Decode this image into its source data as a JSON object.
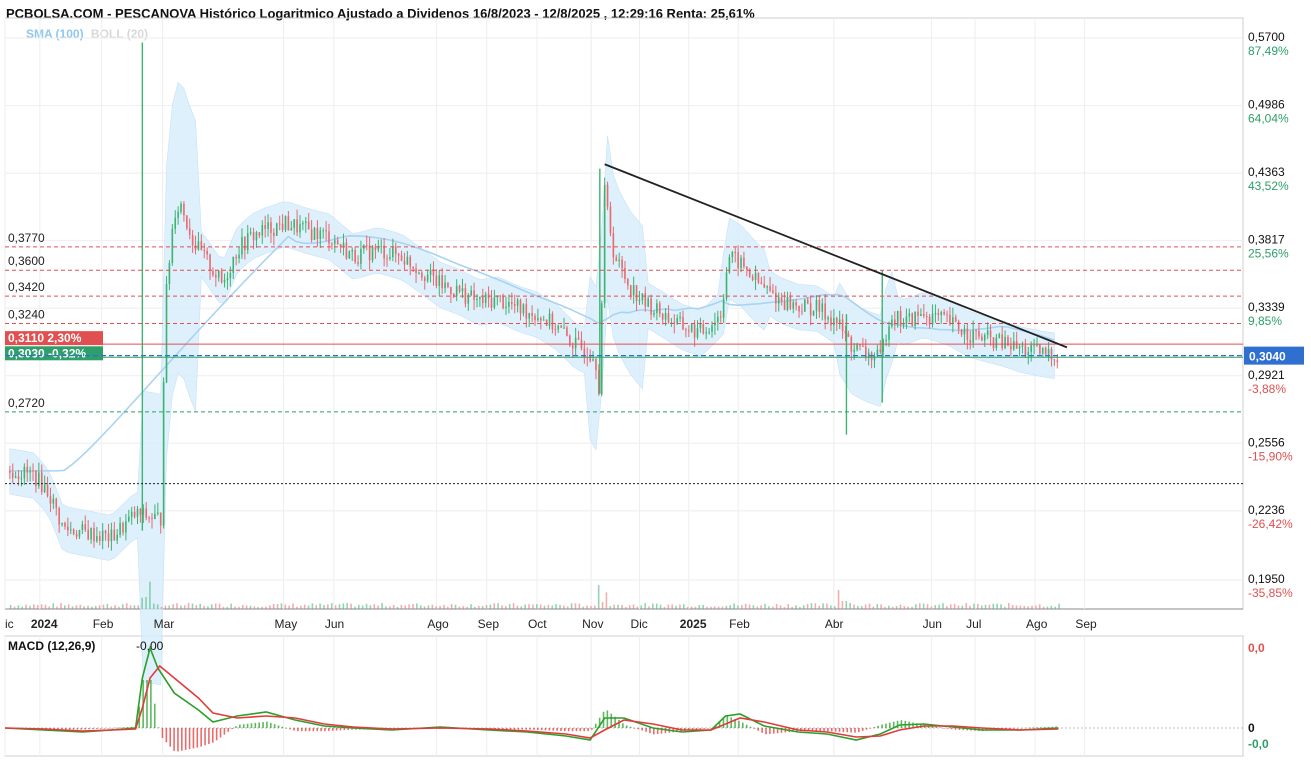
{
  "header": {
    "title": "PCBOLSA.COM - PESCANOVA Histórico Logaritmico Ajustado a Dividenos 16/8/2023 - 12/8/2025 , 12:29:16 Renta: 25,61%",
    "indicator_sma": "SMA (100)",
    "indicator_boll": "BOLL (20)"
  },
  "colors": {
    "up": "#3cb371",
    "down": "#e8696e",
    "band_fill": "#d6ecfb",
    "sma": "#a9d3f2",
    "resistance": "#e05050",
    "support": "#2e9e6a",
    "current": "#2f6fd0",
    "trendline": "#222222",
    "macd_line": "#2aa02a",
    "signal_line": "#e23b3b"
  },
  "chart_data": [
    {
      "type": "candlestick",
      "scale": "log",
      "ylim": [
        0.195,
        0.57
      ],
      "y_ticks": [
        {
          "value": "0,5700",
          "pct": "87,49%"
        },
        {
          "value": "0,4986",
          "pct": "64,04%"
        },
        {
          "value": "0,4363",
          "pct": "43,52%"
        },
        {
          "value": "0,3817",
          "pct": "25,56%"
        },
        {
          "value": "0,3339",
          "pct": "9,85%"
        },
        {
          "value": "0,2921",
          "pct": "-3,88%"
        },
        {
          "value": "0,2556",
          "pct": "-15,90%"
        },
        {
          "value": "0,2236",
          "pct": "-26,42%"
        },
        {
          "value": "0,1950",
          "pct": "-35,85%"
        }
      ],
      "x_ticks": [
        {
          "label": "ic",
          "t": 0.0,
          "bold": false
        },
        {
          "label": "2024",
          "t": 36,
          "bold": true
        },
        {
          "label": "Feb",
          "t": 100,
          "bold": false
        },
        {
          "label": "Mar",
          "t": 163,
          "bold": false
        },
        {
          "label": "May",
          "t": 288,
          "bold": false
        },
        {
          "label": "Jun",
          "t": 340,
          "bold": false
        },
        {
          "label": "Ago",
          "t": 446,
          "bold": false
        },
        {
          "label": "Sep",
          "t": 498,
          "bold": false
        },
        {
          "label": "Oct",
          "t": 550,
          "bold": false
        },
        {
          "label": "Nov",
          "t": 606,
          "bold": false
        },
        {
          "label": "Dic",
          "t": 656,
          "bold": false
        },
        {
          "label": "2025",
          "t": 707,
          "bold": true
        },
        {
          "label": "Feb",
          "t": 758,
          "bold": false
        },
        {
          "label": "Abr",
          "t": 857,
          "bold": false
        },
        {
          "label": "Jun",
          "t": 958,
          "bold": false
        },
        {
          "label": "Jul",
          "t": 1003,
          "bold": false
        },
        {
          "label": "Ago",
          "t": 1065,
          "bold": false
        },
        {
          "label": "Sep",
          "t": 1116,
          "bold": false
        }
      ],
      "t_range": [
        0,
        1280
      ],
      "levels": [
        {
          "label": "0,3770",
          "value": 0.377,
          "kind": "resistance"
        },
        {
          "label": "0,3600",
          "value": 0.36,
          "kind": "resistance"
        },
        {
          "label": "0,3420",
          "value": 0.342,
          "kind": "resistance"
        },
        {
          "label": "0,3240",
          "value": 0.324,
          "kind": "resistance"
        },
        {
          "label": "0,2720",
          "value": 0.272,
          "kind": "support"
        }
      ],
      "other_line": {
        "value": 0.236
      },
      "boxes": [
        {
          "label": "0,3110",
          "pct": "2,30%",
          "value": 0.311,
          "kind": "resistance"
        },
        {
          "label": "0,3030",
          "pct": "-0,32%",
          "value": 0.303,
          "kind": "support"
        }
      ],
      "current": {
        "label": "0,3040",
        "value": 0.304
      },
      "trendline": {
        "t0": 620,
        "v0": 0.444,
        "t1": 1098,
        "v1": 0.309
      },
      "price_path": [
        [
          5,
          0.242
        ],
        [
          30,
          0.24
        ],
        [
          45,
          0.232
        ],
        [
          60,
          0.216
        ],
        [
          85,
          0.214
        ],
        [
          110,
          0.212
        ],
        [
          135,
          0.222
        ],
        [
          162,
          0.22
        ],
        [
          165,
          0.33
        ],
        [
          175,
          0.405
        ],
        [
          182,
          0.41
        ],
        [
          195,
          0.38
        ],
        [
          210,
          0.365
        ],
        [
          225,
          0.35
        ],
        [
          240,
          0.375
        ],
        [
          255,
          0.385
        ],
        [
          270,
          0.39
        ],
        [
          290,
          0.395
        ],
        [
          310,
          0.39
        ],
        [
          335,
          0.385
        ],
        [
          360,
          0.37
        ],
        [
          385,
          0.375
        ],
        [
          410,
          0.37
        ],
        [
          430,
          0.36
        ],
        [
          450,
          0.35
        ],
        [
          470,
          0.345
        ],
        [
          490,
          0.338
        ],
        [
          510,
          0.34
        ],
        [
          530,
          0.334
        ],
        [
          550,
          0.33
        ],
        [
          570,
          0.322
        ],
        [
          590,
          0.31
        ],
        [
          610,
          0.305
        ],
        [
          615,
          0.282
        ],
        [
          620,
          0.42
        ],
        [
          630,
          0.37
        ],
        [
          645,
          0.35
        ],
        [
          660,
          0.338
        ],
        [
          680,
          0.33
        ],
        [
          700,
          0.322
        ],
        [
          720,
          0.318
        ],
        [
          740,
          0.33
        ],
        [
          748,
          0.37
        ],
        [
          760,
          0.365
        ],
        [
          780,
          0.35
        ],
        [
          800,
          0.34
        ],
        [
          820,
          0.335
        ],
        [
          840,
          0.334
        ],
        [
          860,
          0.325
        ],
        [
          875,
          0.31
        ],
        [
          890,
          0.305
        ],
        [
          905,
          0.302
        ],
        [
          915,
          0.33
        ],
        [
          930,
          0.325
        ],
        [
          950,
          0.33
        ],
        [
          975,
          0.325
        ],
        [
          995,
          0.318
        ],
        [
          1010,
          0.315
        ],
        [
          1030,
          0.312
        ],
        [
          1050,
          0.308
        ],
        [
          1075,
          0.305
        ],
        [
          1089,
          0.304
        ]
      ],
      "spikes": [
        {
          "t": 142,
          "high": 0.565,
          "low": 0.215
        },
        {
          "t": 615,
          "high": 0.44,
          "low": 0.282
        },
        {
          "t": 870,
          "high": 0.33,
          "low": 0.26
        },
        {
          "t": 907,
          "high": 0.36,
          "low": 0.277
        }
      ]
    },
    {
      "type": "line",
      "title": "MACD (12,26,9)",
      "last_value": "-0,00",
      "y_ticks": [
        {
          "label": "0,0",
          "pos": "top",
          "kind": "resistance"
        },
        {
          "label": "0",
          "pos": "mid",
          "kind": "neutral"
        },
        {
          "label": "-0,0",
          "pos": "bottom",
          "kind": "support"
        }
      ],
      "macd_path": [
        [
          0,
          0.0
        ],
        [
          40,
          -0.002
        ],
        [
          80,
          -0.004
        ],
        [
          110,
          -0.002
        ],
        [
          135,
          0.0
        ],
        [
          142,
          0.05
        ],
        [
          150,
          0.08
        ],
        [
          158,
          0.06
        ],
        [
          175,
          0.035
        ],
        [
          200,
          0.018
        ],
        [
          215,
          0.006
        ],
        [
          240,
          0.012
        ],
        [
          270,
          0.016
        ],
        [
          300,
          0.008
        ],
        [
          330,
          0.002
        ],
        [
          360,
          0.0
        ],
        [
          400,
          -0.002
        ],
        [
          450,
          0.001
        ],
        [
          500,
          -0.002
        ],
        [
          540,
          -0.004
        ],
        [
          580,
          -0.008
        ],
        [
          605,
          -0.012
        ],
        [
          620,
          0.01
        ],
        [
          640,
          0.01
        ],
        [
          670,
          0.0
        ],
        [
          700,
          -0.004
        ],
        [
          730,
          -0.002
        ],
        [
          745,
          0.012
        ],
        [
          760,
          0.014
        ],
        [
          785,
          0.002
        ],
        [
          820,
          -0.004
        ],
        [
          850,
          -0.006
        ],
        [
          880,
          -0.012
        ],
        [
          905,
          -0.006
        ],
        [
          925,
          0.003
        ],
        [
          950,
          0.004
        ],
        [
          980,
          0.001
        ],
        [
          1010,
          -0.002
        ],
        [
          1050,
          -0.002
        ],
        [
          1089,
          0.0
        ]
      ],
      "signal_path": [
        [
          0,
          0.0
        ],
        [
          40,
          -0.001
        ],
        [
          80,
          -0.003
        ],
        [
          110,
          -0.002
        ],
        [
          135,
          -0.001
        ],
        [
          142,
          0.02
        ],
        [
          150,
          0.05
        ],
        [
          160,
          0.062
        ],
        [
          175,
          0.05
        ],
        [
          200,
          0.03
        ],
        [
          215,
          0.015
        ],
        [
          240,
          0.01
        ],
        [
          270,
          0.012
        ],
        [
          300,
          0.01
        ],
        [
          330,
          0.004
        ],
        [
          360,
          0.001
        ],
        [
          400,
          -0.001
        ],
        [
          450,
          0.0
        ],
        [
          500,
          -0.001
        ],
        [
          540,
          -0.003
        ],
        [
          580,
          -0.006
        ],
        [
          605,
          -0.01
        ],
        [
          620,
          -0.002
        ],
        [
          640,
          0.008
        ],
        [
          670,
          0.004
        ],
        [
          700,
          -0.002
        ],
        [
          730,
          -0.002
        ],
        [
          745,
          0.004
        ],
        [
          760,
          0.01
        ],
        [
          785,
          0.006
        ],
        [
          820,
          -0.002
        ],
        [
          850,
          -0.004
        ],
        [
          880,
          -0.009
        ],
        [
          905,
          -0.008
        ],
        [
          925,
          -0.002
        ],
        [
          950,
          0.002
        ],
        [
          980,
          0.002
        ],
        [
          1010,
          0.0
        ],
        [
          1050,
          -0.002
        ],
        [
          1089,
          -0.001
        ]
      ]
    }
  ]
}
